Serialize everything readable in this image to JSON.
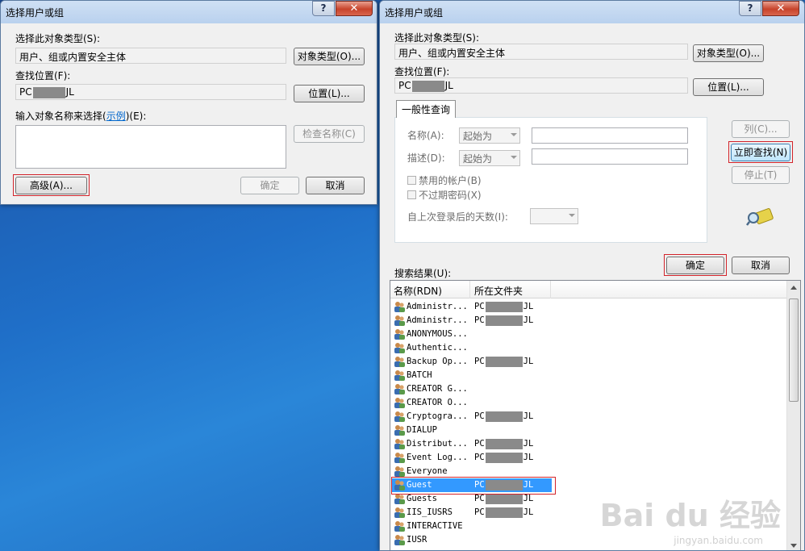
{
  "left_dialog": {
    "title": "选择用户或组",
    "object_type_label": "选择此对象类型(S):",
    "object_type_value": "用户、组或内置安全主体",
    "object_type_button": "对象类型(O)...",
    "location_label": "查找位置(F):",
    "location_prefix": "PC",
    "location_suffix": "JL",
    "location_button": "位置(L)...",
    "enter_names_label_pre": "输入对象名称来选择(",
    "enter_names_link": "示例",
    "enter_names_label_post": ")(E):",
    "check_names_button": "检查名称(C)",
    "advanced_button": "高级(A)...",
    "ok_button": "确定",
    "cancel_button": "取消"
  },
  "right_dialog": {
    "title": "选择用户或组",
    "object_type_label": "选择此对象类型(S):",
    "object_type_value": "用户、组或内置安全主体",
    "object_type_button": "对象类型(O)...",
    "location_label": "查找位置(F):",
    "location_prefix": "PC",
    "location_suffix": "JL",
    "location_button": "位置(L)...",
    "tab_label": "一般性查询",
    "name_label": "名称(A):",
    "name_combo": "起始为",
    "desc_label": "描述(D):",
    "desc_combo": "起始为",
    "disabled_accounts": "禁用的帐户(B)",
    "non_expiring_pw": "不过期密码(X)",
    "days_since_login": "自上次登录后的天数(I):",
    "columns_button": "列(C)...",
    "find_now_button": "立即查找(N)",
    "stop_button": "停止(T)",
    "ok_button": "确定",
    "cancel_button": "取消",
    "results_label": "搜索结果(U):",
    "col_name": "名称(RDN)",
    "col_folder": "所在文件夹",
    "rows": [
      {
        "name": "Administr...",
        "folder_prefix": "PC",
        "folder_suffix": "JL"
      },
      {
        "name": "Administr...",
        "folder_prefix": "PC",
        "folder_suffix": "JL"
      },
      {
        "name": "ANONYMOUS...",
        "folder_prefix": "",
        "folder_suffix": ""
      },
      {
        "name": "Authentic...",
        "folder_prefix": "",
        "folder_suffix": ""
      },
      {
        "name": "Backup Op...",
        "folder_prefix": "PC",
        "folder_suffix": "JL"
      },
      {
        "name": "BATCH",
        "folder_prefix": "",
        "folder_suffix": ""
      },
      {
        "name": "CREATOR G...",
        "folder_prefix": "",
        "folder_suffix": ""
      },
      {
        "name": "CREATOR O...",
        "folder_prefix": "",
        "folder_suffix": ""
      },
      {
        "name": "Cryptogra...",
        "folder_prefix": "PC",
        "folder_suffix": "JL"
      },
      {
        "name": "DIALUP",
        "folder_prefix": "",
        "folder_suffix": ""
      },
      {
        "name": "Distribut...",
        "folder_prefix": "PC",
        "folder_suffix": "JL"
      },
      {
        "name": "Event Log...",
        "folder_prefix": "PC",
        "folder_suffix": "JL"
      },
      {
        "name": "Everyone",
        "folder_prefix": "",
        "folder_suffix": ""
      },
      {
        "name": "Guest",
        "folder_prefix": "PC",
        "folder_suffix": "JL"
      },
      {
        "name": "Guests",
        "folder_prefix": "PC",
        "folder_suffix": "JL"
      },
      {
        "name": "IIS_IUSRS",
        "folder_prefix": "PC",
        "folder_suffix": "JL"
      },
      {
        "name": "INTERACTIVE",
        "folder_prefix": "",
        "folder_suffix": ""
      },
      {
        "name": "IUSR",
        "folder_prefix": "",
        "folder_suffix": ""
      }
    ],
    "selected_row": "Guest"
  },
  "watermark": {
    "main": "Bai du 经验",
    "sub": "jingyan.baidu.com"
  },
  "colors": {
    "highlight_box": "#d2232a",
    "selection": "#3399ff",
    "desktop": "#1f6fc8"
  }
}
